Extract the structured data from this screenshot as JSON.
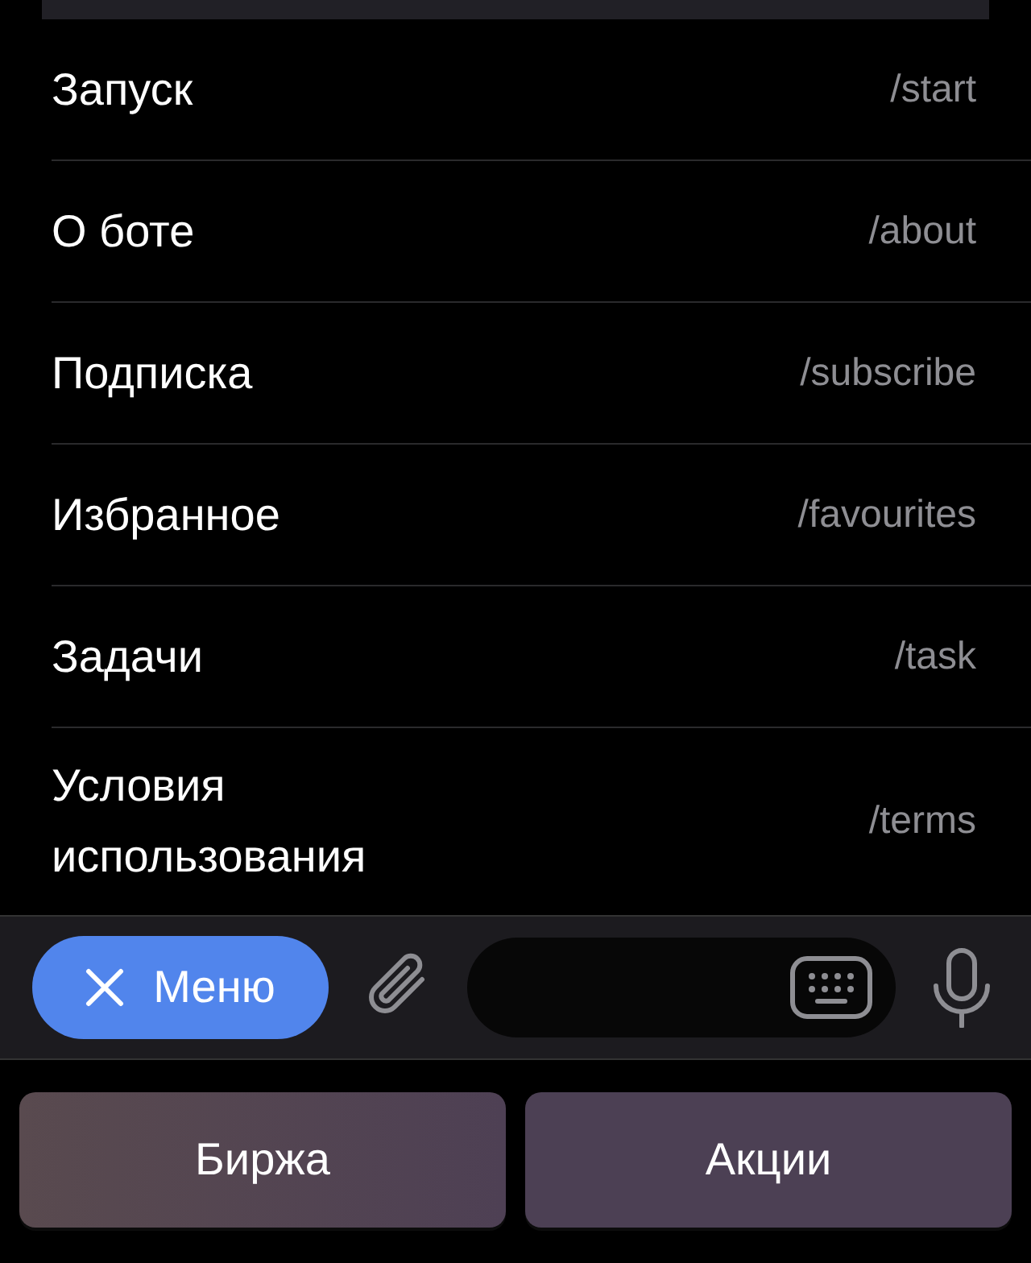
{
  "commands": [
    {
      "title": "Запуск",
      "command": "/start"
    },
    {
      "title": "О боте",
      "command": "/about"
    },
    {
      "title": "Подписка",
      "command": "/subscribe"
    },
    {
      "title": "Избранное",
      "command": "/favourites"
    },
    {
      "title": "Задачи",
      "command": "/task"
    },
    {
      "title": "Условия использования",
      "command": "/terms"
    }
  ],
  "input_bar": {
    "menu_button": "Меню"
  },
  "keyboard_buttons": [
    "Биржа",
    "Акции"
  ]
}
